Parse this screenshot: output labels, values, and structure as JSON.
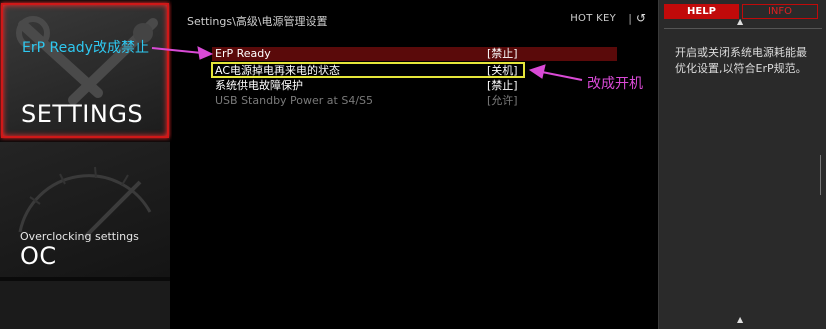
{
  "nav": {
    "settings_label": "SETTINGS",
    "oc_subtitle": "Overclocking settings",
    "oc_label": "OC"
  },
  "header": {
    "breadcrumb": "Settings\\高级\\电源管理设置",
    "hotkey": "HOT KEY",
    "separator": "|",
    "back_icon": "↺"
  },
  "settings": [
    {
      "label": "ErP Ready",
      "value": "[禁止]",
      "state": "selected"
    },
    {
      "label": "AC电源掉电再来电的状态",
      "value": "[关机]",
      "state": "normal"
    },
    {
      "label": "系统供电故障保护",
      "value": "[禁止]",
      "state": "normal"
    },
    {
      "label": "USB Standby Power at S4/S5",
      "value": "[允许]",
      "state": "disabled"
    }
  ],
  "annotations": {
    "left": "ErP Ready改成禁止",
    "right": "改成开机",
    "arrow_color": "#d94ad6",
    "box_color": "#e6e63a"
  },
  "help_panel": {
    "help_tab": "HELP",
    "info_tab": "INFO",
    "text": "开启或关闭系统电源耗能最优化设置,以符合ErP规范。"
  },
  "colors": {
    "accent": "#c10a0a",
    "selected_row": "#5a0a0a",
    "disabled_text": "#7a7a7a"
  }
}
